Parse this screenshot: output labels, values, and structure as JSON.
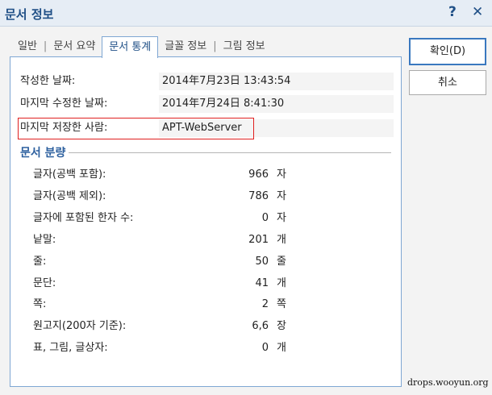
{
  "title": "문서 정보",
  "title_buttons": {
    "help": "?",
    "close": "✕"
  },
  "tabs": [
    {
      "label": "일반"
    },
    {
      "label": "문서 요약"
    },
    {
      "label": "문서 통계"
    },
    {
      "label": "글꼴 정보"
    },
    {
      "label": "그림 정보"
    }
  ],
  "active_tab": "문서 통계",
  "info": [
    {
      "label": "작성한 날짜:",
      "value": "2014年7月23日 13:43:54"
    },
    {
      "label": "마지막 수정한 날짜:",
      "value": "2014年7月24日 8:41:30"
    },
    {
      "label": "마지막 저장한 사람:",
      "value": "APT-WebServer"
    }
  ],
  "section_title": "문서 분량",
  "stats": [
    {
      "label": "글자(공백 포함):",
      "value": "966",
      "unit": "자"
    },
    {
      "label": "글자(공백 제외):",
      "value": "786",
      "unit": "자"
    },
    {
      "label": "글자에 포함된 한자 수:",
      "value": "0",
      "unit": "자"
    },
    {
      "label": "낱말:",
      "value": "201",
      "unit": "개"
    },
    {
      "label": "줄:",
      "value": "50",
      "unit": "줄"
    },
    {
      "label": "문단:",
      "value": "41",
      "unit": "개"
    },
    {
      "label": "쪽:",
      "value": "2",
      "unit": "쪽"
    },
    {
      "label": "원고지(200자 기준):",
      "value": "6,6",
      "unit": "장"
    },
    {
      "label": "표, 그림, 글상자:",
      "value": "0",
      "unit": "개"
    }
  ],
  "buttons": {
    "ok": "확인(D)",
    "cancel": "취소"
  },
  "watermark": "drops.wooyun.org"
}
